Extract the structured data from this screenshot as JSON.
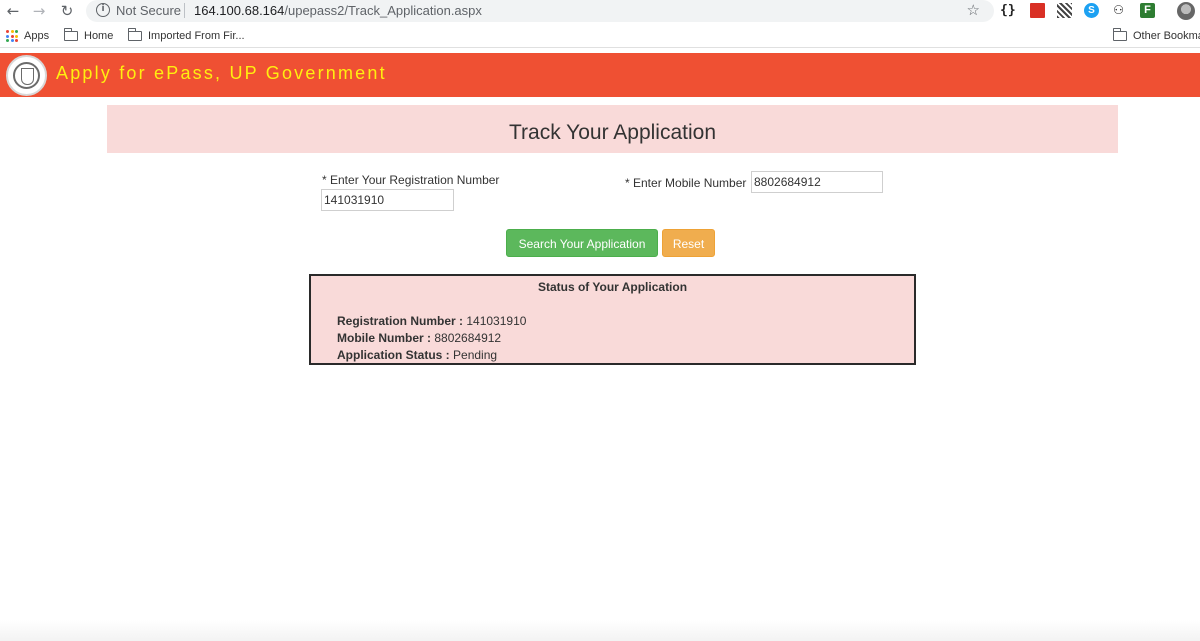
{
  "browser": {
    "nav": {
      "back": "←",
      "forward": "→",
      "reload": "↻"
    },
    "omnibox": {
      "security_text": "Not Secure",
      "url_host": "164.100.68.164",
      "url_path": "/upepass2/Track_Application.aspx"
    },
    "extensions": [
      "json-viewer-icon",
      "red-extension-icon",
      "qr-code-icon",
      "skype-icon",
      "incognito-mask-icon",
      "green-extension-icon",
      "profile-avatar"
    ],
    "bookmarks": {
      "apps_label": "Apps",
      "items": [
        {
          "label": "Home"
        },
        {
          "label": "Imported From Fir..."
        }
      ],
      "other_label": "Other Bookmarks"
    },
    "apps_grid_colors": [
      "#ea4335",
      "#fbbc05",
      "#34a853",
      "#4285f4",
      "#ea4335",
      "#fbbc05",
      "#34a853",
      "#4285f4",
      "#ea4335"
    ]
  },
  "header": {
    "title": "Apply for ePass, UP Government",
    "bg_color": "#ef5033",
    "title_color": "#ffee10"
  },
  "page": {
    "heading": "Track Your Application",
    "form": {
      "registration_label": "* Enter Your Registration Number",
      "registration_value": "141031910",
      "mobile_label": "* Enter Mobile Number",
      "mobile_value": "8802684912"
    },
    "buttons": {
      "search": "Search Your Application",
      "reset": "Reset"
    },
    "status": {
      "heading": "Status of Your Application",
      "registration_label": "Registration Number :",
      "registration_value": "141031910",
      "mobile_label": "Mobile Number :",
      "mobile_value": "8802684912",
      "status_label": "Application Status :",
      "status_value": "Pending"
    }
  }
}
